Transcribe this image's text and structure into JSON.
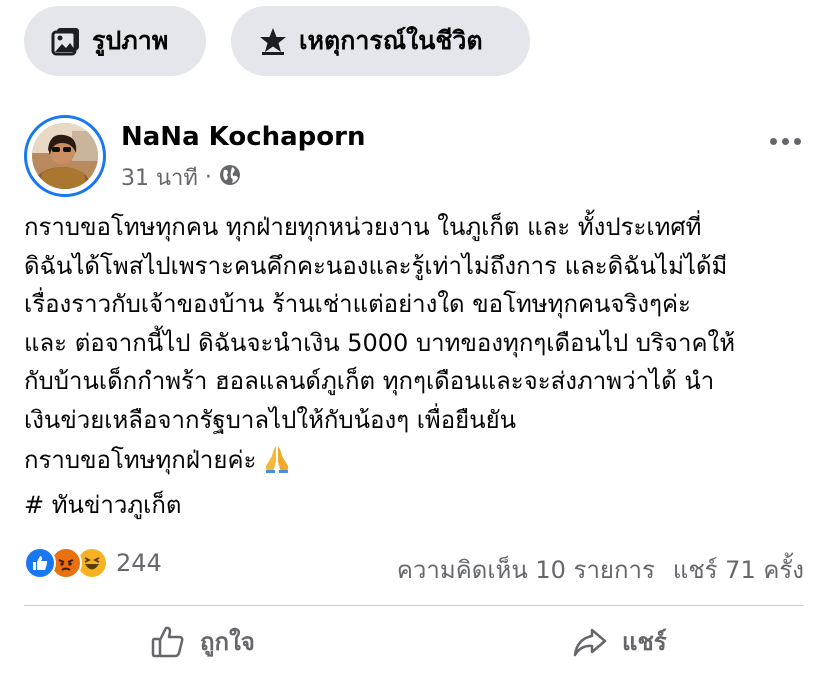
{
  "composer": {
    "photo_label": "รูปภาพ",
    "life_event_label": "เหตุการณ์ในชีวิต"
  },
  "post": {
    "author": "NaNa Kochaporn",
    "time": "31 นาที",
    "audience_icon": "globe-icon",
    "lines": [
      "กราบขอโทษทุกคน ทุกฝ่ายทุกหน่วยงาน ในภูเก็ต และ ทั้งประเทศที่",
      "ดิฉันได้โพสไปเพราะคนคึกคะนองและรู้เท่าไม่ถึงการ และดิฉันไม่ได้มี",
      "เรื่องราวกับเจ้าของบ้าน ร้านเช่าแต่อย่างใด ขอโทษทุกคนจริงๆค่ะ",
      "และ ต่อจากนี้ไป ดิฉันจะนำเงิน 5000 บาทของทุกๆเดือนไป บริจาคให้",
      "กับบ้านเด็กกำพร้า ฮอลแลนด์ภูเก็ต ทุกๆเดือนและจะส่งภาพว่าได้ นำ",
      "เงินข่วยเหลือจากรัฐบาลไปให้กับน้องๆ เพื่อยืนยัน"
    ],
    "apology": "กราบขอโทษทุกฝ่ายค่ะ",
    "apology_emoji": "folded-hands-emoji",
    "hashtag": "# ทันข่าวภูเก็ต"
  },
  "reactions": {
    "types": [
      "like",
      "angry",
      "haha"
    ],
    "count": "244",
    "colors": {
      "like": "#1877f2",
      "angry": "#e9710f",
      "haha": "#f7b125"
    }
  },
  "stats": {
    "comments": "ความคิดเห็น 10 รายการ",
    "shares": "แชร์ 71 ครั้ง"
  },
  "actions": {
    "like_label": "ถูกใจ",
    "share_label": "แชร์"
  }
}
